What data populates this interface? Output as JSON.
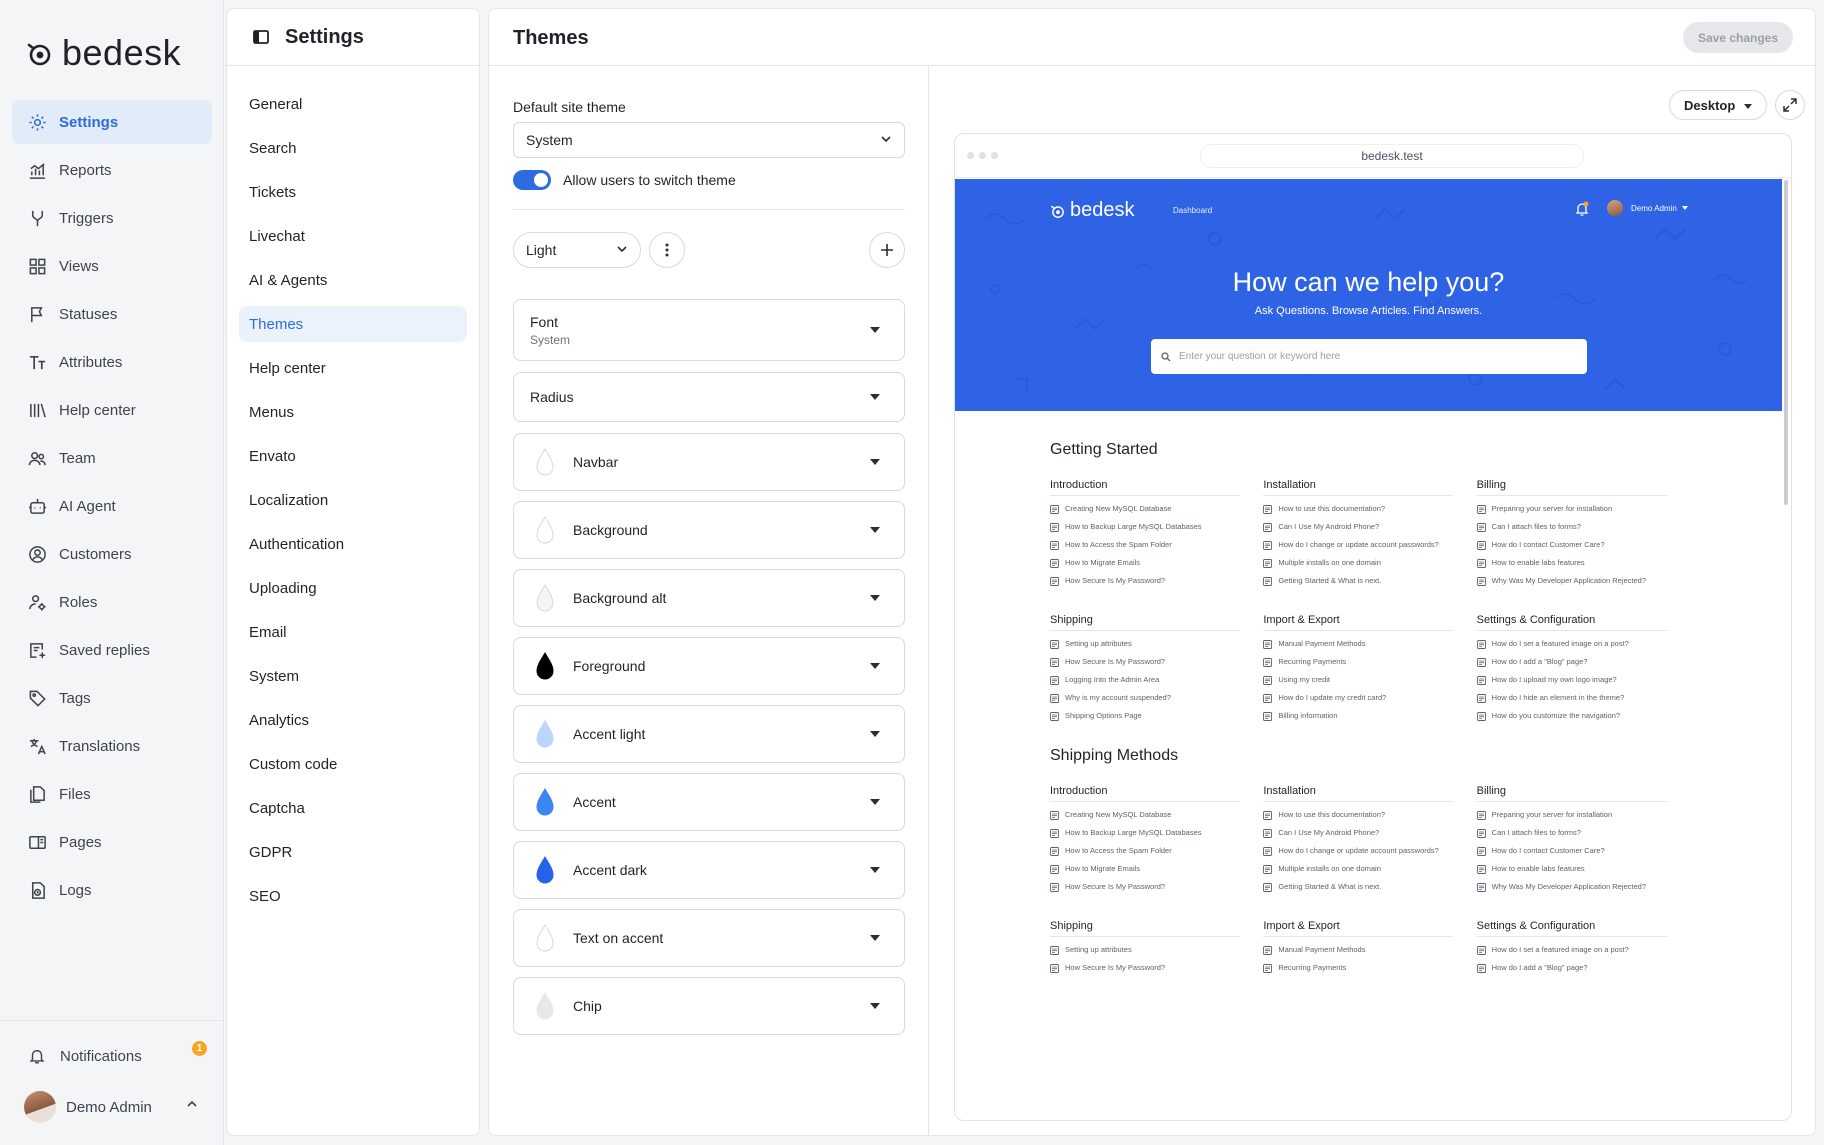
{
  "brand": {
    "name": "bedesk"
  },
  "nav": {
    "items": [
      {
        "label": "Settings",
        "icon": "gear-icon",
        "active": true
      },
      {
        "label": "Reports",
        "icon": "chart-icon"
      },
      {
        "label": "Triggers",
        "icon": "branch-icon"
      },
      {
        "label": "Views",
        "icon": "grid-icon"
      },
      {
        "label": "Statuses",
        "icon": "flag-icon"
      },
      {
        "label": "Attributes",
        "icon": "text-size-icon"
      },
      {
        "label": "Help center",
        "icon": "library-icon"
      },
      {
        "label": "Team",
        "icon": "team-icon"
      },
      {
        "label": "AI Agent",
        "icon": "bot-icon"
      },
      {
        "label": "Customers",
        "icon": "user-circle-icon"
      },
      {
        "label": "Roles",
        "icon": "user-cog-icon"
      },
      {
        "label": "Saved replies",
        "icon": "saved-replies-icon"
      },
      {
        "label": "Tags",
        "icon": "tag-icon"
      },
      {
        "label": "Translations",
        "icon": "translate-icon"
      },
      {
        "label": "Files",
        "icon": "files-icon"
      },
      {
        "label": "Pages",
        "icon": "pages-icon"
      },
      {
        "label": "Logs",
        "icon": "logs-icon"
      }
    ],
    "notifications_label": "Notifications",
    "notifications_count": "1",
    "user_name": "Demo Admin"
  },
  "settings": {
    "title": "Settings",
    "items": [
      {
        "label": "General"
      },
      {
        "label": "Search"
      },
      {
        "label": "Tickets"
      },
      {
        "label": "Livechat"
      },
      {
        "label": "AI & Agents"
      },
      {
        "label": "Themes",
        "active": true
      },
      {
        "label": "Help center"
      },
      {
        "label": "Menus"
      },
      {
        "label": "Envato"
      },
      {
        "label": "Localization"
      },
      {
        "label": "Authentication"
      },
      {
        "label": "Uploading"
      },
      {
        "label": "Email"
      },
      {
        "label": "System"
      },
      {
        "label": "Analytics"
      },
      {
        "label": "Custom code"
      },
      {
        "label": "Captcha"
      },
      {
        "label": "GDPR"
      },
      {
        "label": "SEO"
      }
    ]
  },
  "main": {
    "title": "Themes",
    "save_label": "Save changes",
    "default_theme_label": "Default site theme",
    "default_theme_value": "System",
    "allow_switch_label": "Allow users to switch theme",
    "theme_value": "Light",
    "font": {
      "label": "Font",
      "value": "System"
    },
    "radius_label": "Radius",
    "colors": [
      {
        "label": "Navbar",
        "color": "#ffffff"
      },
      {
        "label": "Background",
        "color": "#ffffff"
      },
      {
        "label": "Background alt",
        "color": "#f4f5f7"
      },
      {
        "label": "Foreground",
        "color": "#000000"
      },
      {
        "label": "Accent light",
        "color": "#bcd6fb"
      },
      {
        "label": "Accent",
        "color": "#3b86f0"
      },
      {
        "label": "Accent dark",
        "color": "#2563eb"
      },
      {
        "label": "Text on accent",
        "color": "#ffffff"
      },
      {
        "label": "Chip",
        "color": "#e7e8eb"
      }
    ]
  },
  "preview": {
    "device_label": "Desktop",
    "url": "bedesk.test",
    "nav_link": "Dashboard",
    "user_name": "Demo Admin",
    "hero_title": "How can we help you?",
    "hero_subtitle": "Ask Questions. Browse Articles. Find Answers.",
    "search_placeholder": "Enter your question or keyword here",
    "sections": [
      {
        "title": "Getting Started",
        "groups": [
          {
            "title": "Introduction",
            "links": [
              "Creating New MySQL Database",
              "How to Backup Large MySQL Databases",
              "How to Access the Spam Folder",
              "How to Migrate Emails",
              "How Secure Is My Password?"
            ]
          },
          {
            "title": "Installation",
            "links": [
              "How to use this documentation?",
              "Can I Use My Android Phone?",
              "How do I change or update account passwords?",
              "Multiple installs on one domain",
              "Getting Started & What is next."
            ]
          },
          {
            "title": "Billing",
            "links": [
              "Preparing your server for installation",
              "Can I attach files to forms?",
              "How do I contact Customer Care?",
              "How to enable labs features",
              "Why Was My Developer Application Rejected?"
            ]
          },
          {
            "title": "Shipping",
            "links": [
              "Setting up attributes",
              "How Secure Is My Password?",
              "Logging Into the Admin Area",
              "Why is my account suspended?",
              "Shipping Options Page"
            ]
          },
          {
            "title": "Import & Export",
            "links": [
              "Manual Payment Methods",
              "Recurring Payments",
              "Using my credit",
              "How do I update my credit card?",
              "Billing information"
            ]
          },
          {
            "title": "Settings & Configuration",
            "links": [
              "How do I set a featured image on a post?",
              "How do I add a \"Blog\" page?",
              "How do I upload my own logo image?",
              "How do I hide an element in the theme?",
              "How do you customize the navigation?"
            ]
          }
        ]
      },
      {
        "title": "Shipping Methods",
        "groups": [
          {
            "title": "Introduction",
            "links": [
              "Creating New MySQL Database",
              "How to Backup Large MySQL Databases",
              "How to Access the Spam Folder",
              "How to Migrate Emails",
              "How Secure Is My Password?"
            ]
          },
          {
            "title": "Installation",
            "links": [
              "How to use this documentation?",
              "Can I Use My Android Phone?",
              "How do I change or update account passwords?",
              "Multiple installs on one domain",
              "Getting Started & What is next."
            ]
          },
          {
            "title": "Billing",
            "links": [
              "Preparing your server for installation",
              "Can I attach files to forms?",
              "How do I contact Customer Care?",
              "How to enable labs features",
              "Why Was My Developer Application Rejected?"
            ]
          },
          {
            "title": "Shipping",
            "links": [
              "Setting up attributes",
              "How Secure Is My Password?"
            ]
          },
          {
            "title": "Import & Export",
            "links": [
              "Manual Payment Methods",
              "Recurring Payments"
            ]
          },
          {
            "title": "Settings & Configuration",
            "links": [
              "How do I set a featured image on a post?",
              "How do I add a \"Blog\" page?"
            ]
          }
        ]
      }
    ]
  }
}
